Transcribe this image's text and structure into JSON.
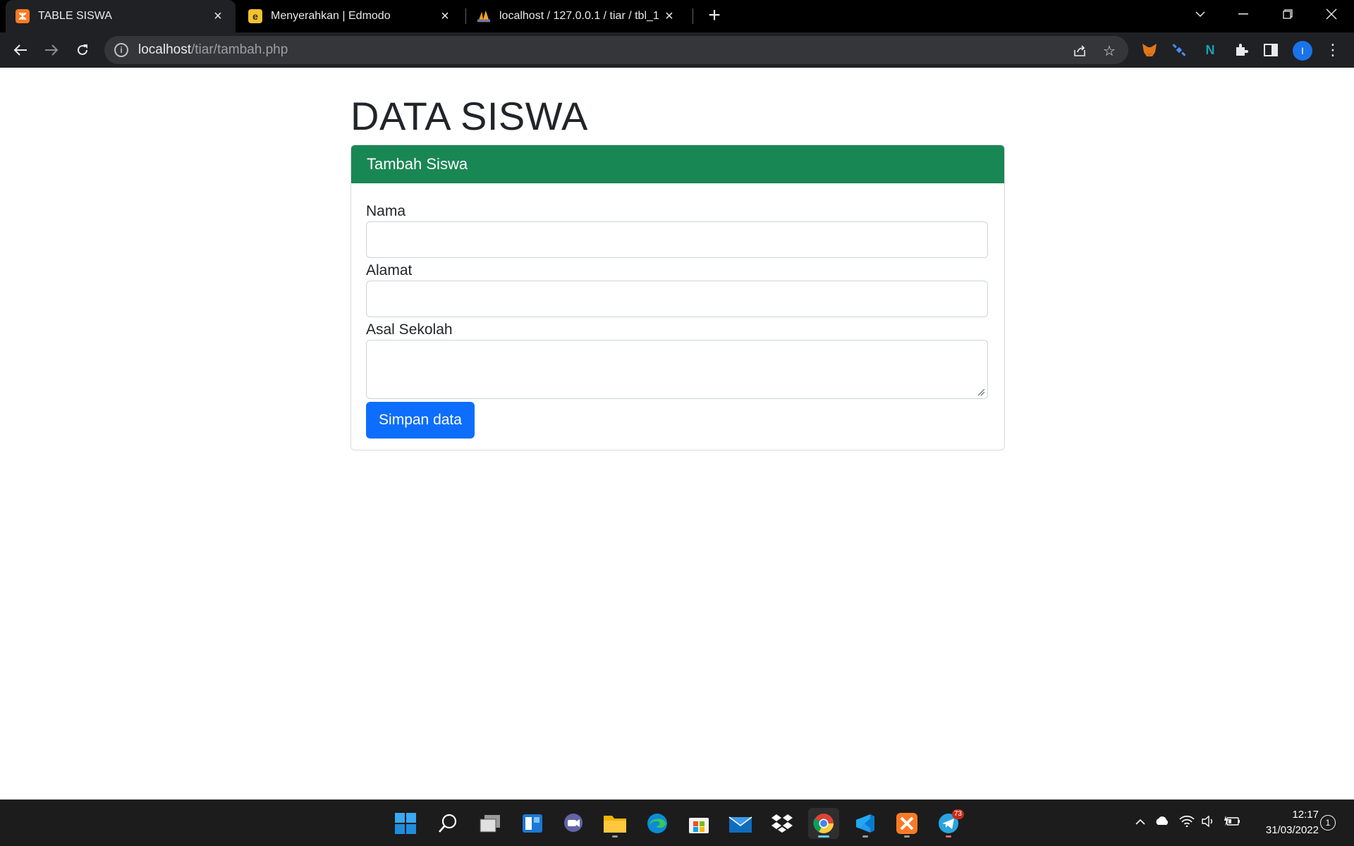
{
  "browser": {
    "tabs": [
      {
        "title": "TABLE SISWA",
        "favicon": "xampp-icon",
        "active": true
      },
      {
        "title": "Menyerahkan | Edmodo",
        "favicon": "edmodo-icon",
        "active": false
      },
      {
        "title": "localhost / 127.0.0.1 / tiar / tbl_1",
        "favicon": "phpmyadmin-icon",
        "active": false
      }
    ],
    "url_host": "localhost",
    "url_path": "/tiar/tambah.php",
    "profile_initial": "I"
  },
  "page": {
    "heading": "DATA SISWA",
    "card_title": "Tambah Siswa",
    "fields": {
      "nama_label": "Nama",
      "nama_value": "",
      "alamat_label": "Alamat",
      "alamat_value": "",
      "asal_sekolah_label": "Asal Sekolah",
      "asal_sekolah_value": ""
    },
    "submit_label": "Simpan data"
  },
  "taskbar": {
    "mail_badge": "73",
    "time": "12:17",
    "date": "31/03/2022",
    "notification_count": "1"
  },
  "colors": {
    "card_header": "#198754",
    "primary_button": "#0d6efd",
    "chrome_bg": "#202124"
  }
}
